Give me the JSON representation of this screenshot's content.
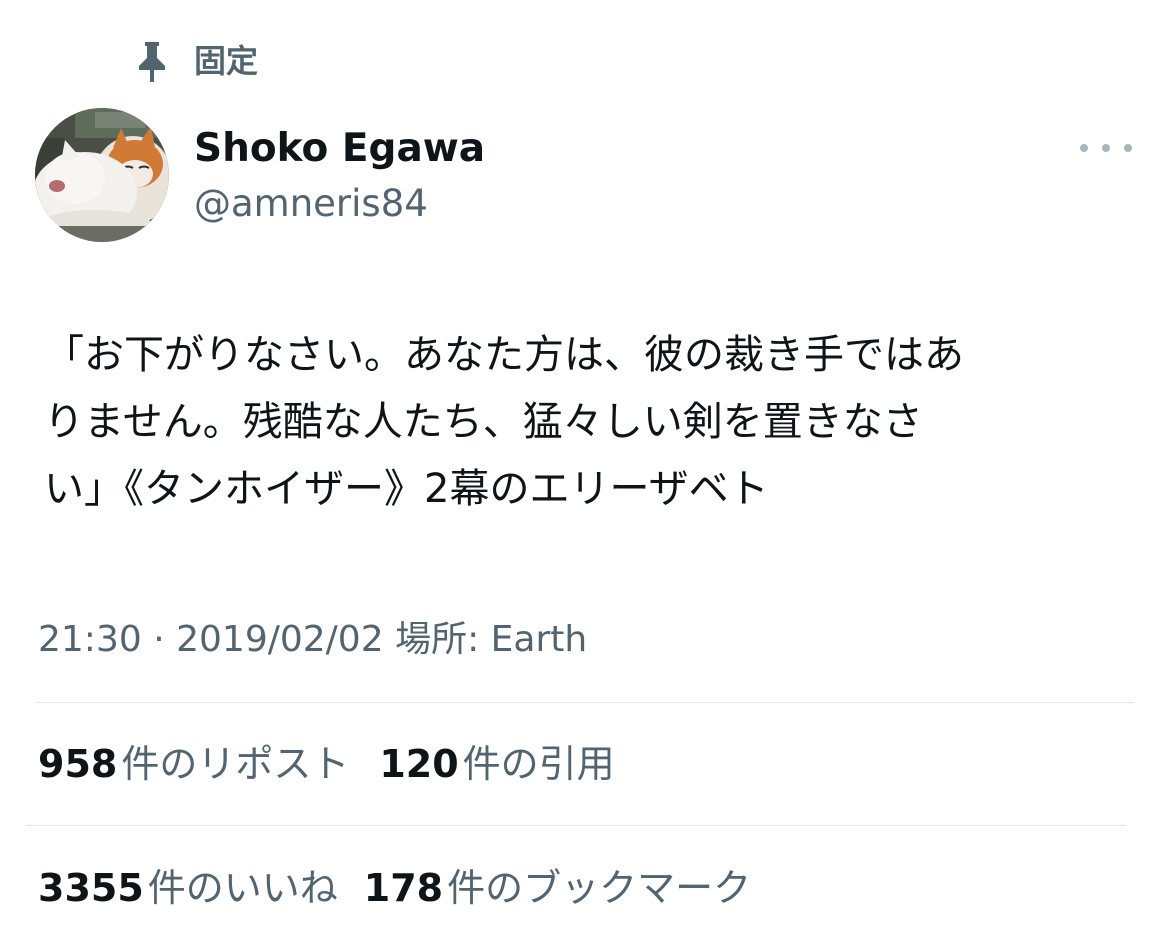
{
  "pinned": {
    "icon": "pin-icon",
    "label": "固定"
  },
  "author": {
    "display_name": "Shoko Egawa",
    "handle": "@amneris84",
    "avatar": "avatar-cats-photo"
  },
  "more_menu": {
    "icon": "more-horizontal-icon"
  },
  "tweet": {
    "text_lines": [
      "「お下がりなさい。あなた方は、彼の裁き手ではあ",
      "りません。残酷な人たち、猛々しい剣を置きなさ",
      "い」《タンホイザー》2幕のエリーザベト"
    ]
  },
  "meta": {
    "time": "21:30",
    "separator": "·",
    "date": "2019/02/02",
    "location_label": "場所:",
    "location": "Earth"
  },
  "stats": {
    "reposts_count": "958",
    "reposts_label": "件のリポスト",
    "quotes_count": "120",
    "quotes_label": "件の引用",
    "likes_count": "3355",
    "likes_label": "件のいいね",
    "bookmarks_count": "178",
    "bookmarks_label": "件のブックマーク"
  },
  "colors": {
    "text_primary": "#0f1419",
    "text_secondary": "#536471",
    "divider": "#e3e7ea"
  }
}
